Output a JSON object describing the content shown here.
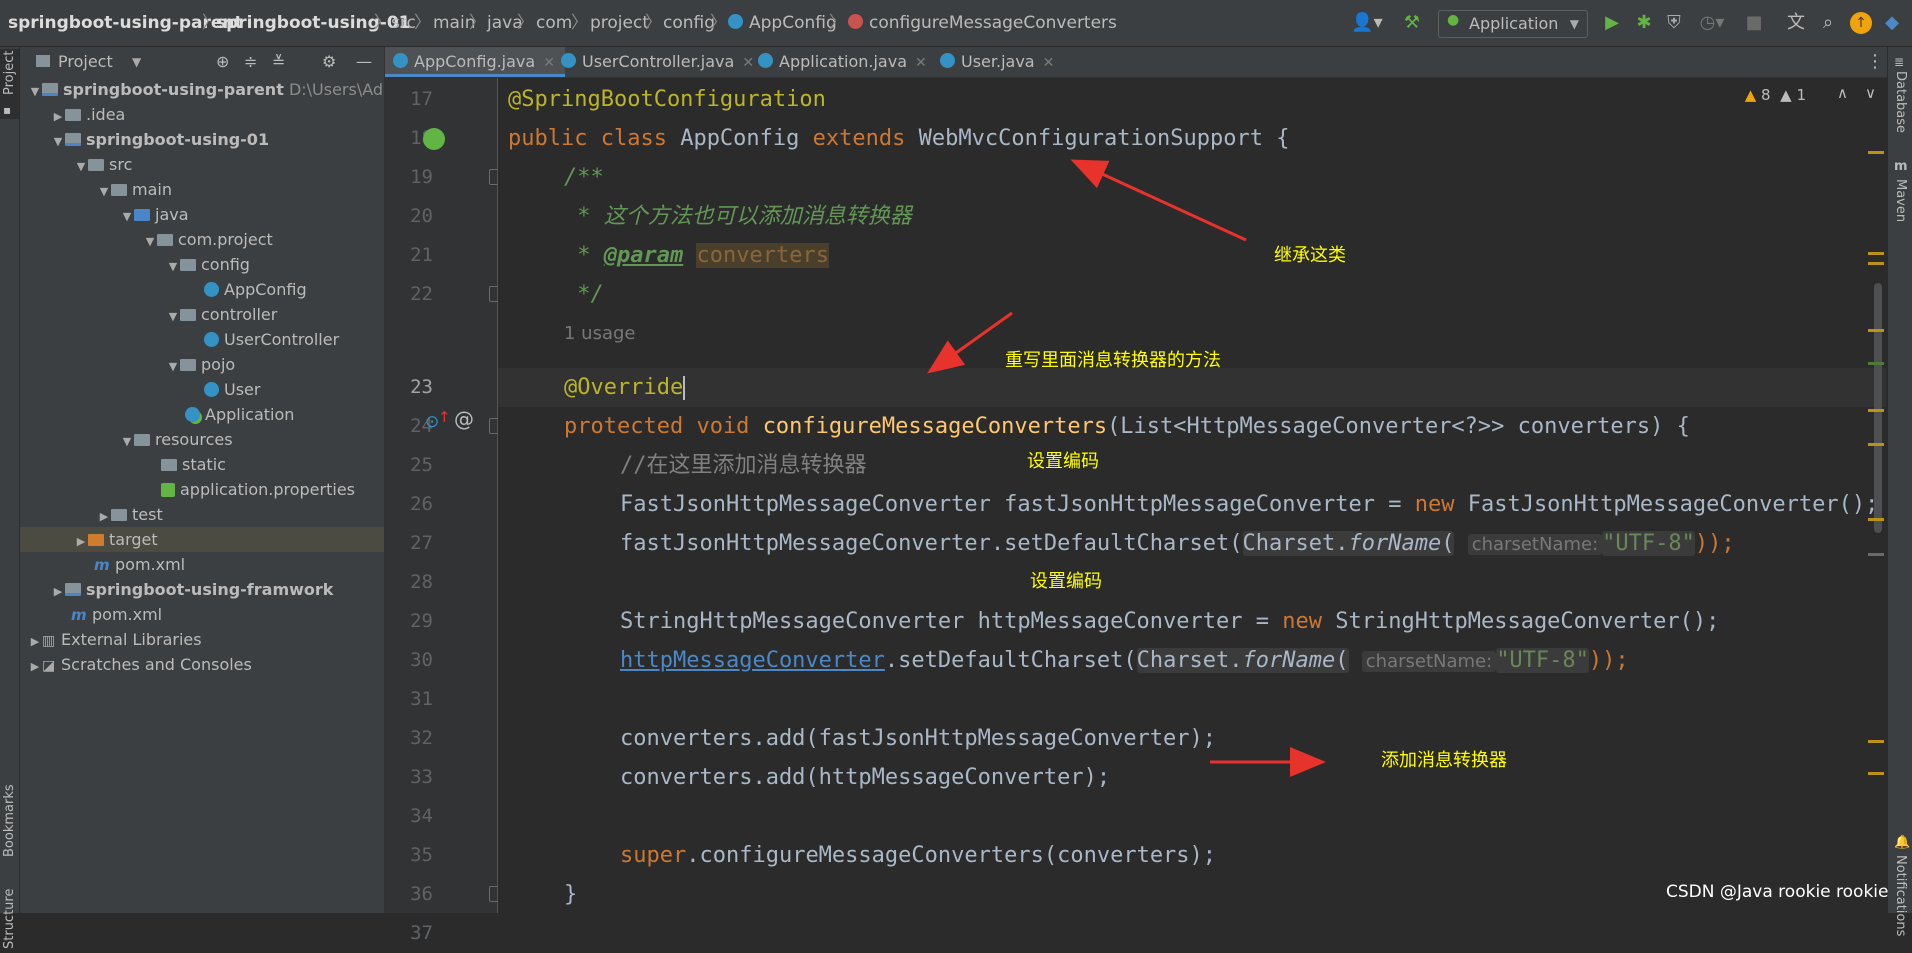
{
  "breadcrumbs": [
    "springboot-using-parent",
    "springboot-using-01",
    "src",
    "main",
    "java",
    "com",
    "project",
    "config",
    "AppConfig",
    "configureMessageConverters"
  ],
  "toolbar": {
    "run_config": "Application"
  },
  "left_strip": {
    "project": "Project",
    "bookmarks": "Bookmarks",
    "structure": "Structure"
  },
  "right_strip": {
    "database": "Database",
    "maven": "Maven",
    "notifications": "Notifications"
  },
  "project_panel": {
    "title": "Project",
    "tree": [
      {
        "label": "springboot-using-parent",
        "extra": "D:\\Users\\Admin"
      },
      {
        "label": ".idea"
      },
      {
        "label": "springboot-using-01"
      },
      {
        "label": "src"
      },
      {
        "label": "main"
      },
      {
        "label": "java"
      },
      {
        "label": "com.project"
      },
      {
        "label": "config"
      },
      {
        "label": "AppConfig"
      },
      {
        "label": "controller"
      },
      {
        "label": "UserController"
      },
      {
        "label": "pojo"
      },
      {
        "label": "User"
      },
      {
        "label": "Application"
      },
      {
        "label": "resources"
      },
      {
        "label": "static"
      },
      {
        "label": "application.properties"
      },
      {
        "label": "test"
      },
      {
        "label": "target"
      },
      {
        "label": "pom.xml"
      },
      {
        "label": "springboot-using-framwork"
      },
      {
        "label": "pom.xml"
      },
      {
        "label": "External Libraries"
      },
      {
        "label": "Scratches and Consoles"
      }
    ]
  },
  "tabs": [
    "AppConfig.java",
    "UserController.java",
    "Application.java",
    "User.java"
  ],
  "inspections": {
    "warnings": "8",
    "weak": "1"
  },
  "editor": {
    "line_numbers": [
      "17",
      "18",
      "19",
      "20",
      "21",
      "22",
      "23",
      "24",
      "25",
      "26",
      "27",
      "28",
      "29",
      "30",
      "31",
      "32",
      "33",
      "34",
      "35",
      "36",
      "37"
    ],
    "usage_hint": "1 usage",
    "code": {
      "l17": "@SpringBootConfiguration",
      "l18_kw1": "public class",
      "l18_name": " AppConfig ",
      "l18_kw2": "extends",
      "l18_rest": " WebMvcConfigurationSupport {",
      "l19": "/**",
      "l20": " * 这个方法也可以添加消息转换器",
      "l21_star": " * ",
      "l21_tag": "@param",
      "l21_param": "converters",
      "l22": " */",
      "l23": "@Override",
      "l24_kw": "protected void",
      "l24_fn": "configureMessageConverters",
      "l24_rest": "(List<HttpMessageConverter<?>> converters) {",
      "l25": "//在这里添加消息转换器",
      "l26_a": "FastJsonHttpMessageConverter fastJsonHttpMessageConverter = ",
      "l26_kw": "new",
      "l26_b": " FastJsonHttpMessageConverter();",
      "l27_a": "fastJsonHttpMessageConverter.setDefaultCharset(",
      "l27_cls": "Charset.",
      "l27_m": "forName",
      "l27_open": "(",
      "hint_name": "charsetName:",
      "l27_str": "\"UTF-8\"",
      "l27_close": "));",
      "l29_a": "StringHttpMessageConverter httpMessageConverter = ",
      "l29_kw": "new",
      "l29_b": " StringHttpMessageConverter();",
      "l30_link": "httpMessageConverter",
      "l30_a": ".setDefaultCharset(",
      "l30_cls": "Charset.",
      "l30_m": "forName",
      "l30_open": "(",
      "l30_str": "\"UTF-8\"",
      "l30_close": "));",
      "l32": "converters.add(fastJsonHttpMessageConverter);",
      "l33": "converters.add(httpMessageConverter);",
      "l35_kw": "super",
      "l35_rest": ".configureMessageConverters(converters);",
      "l36": "}"
    }
  },
  "annotations": {
    "inherit": "继承这类",
    "override": "重写里面消息转换器的方法",
    "encoding1": "设置编码",
    "encoding2": "设置编码",
    "add": "添加消息转换器"
  },
  "watermark": "CSDN @Java rookie rookie",
  "colors": {
    "accent": "#4a88c7",
    "keyword": "#cc7832",
    "annotation_text": "#ffff00",
    "arrow": "#e8322c"
  }
}
